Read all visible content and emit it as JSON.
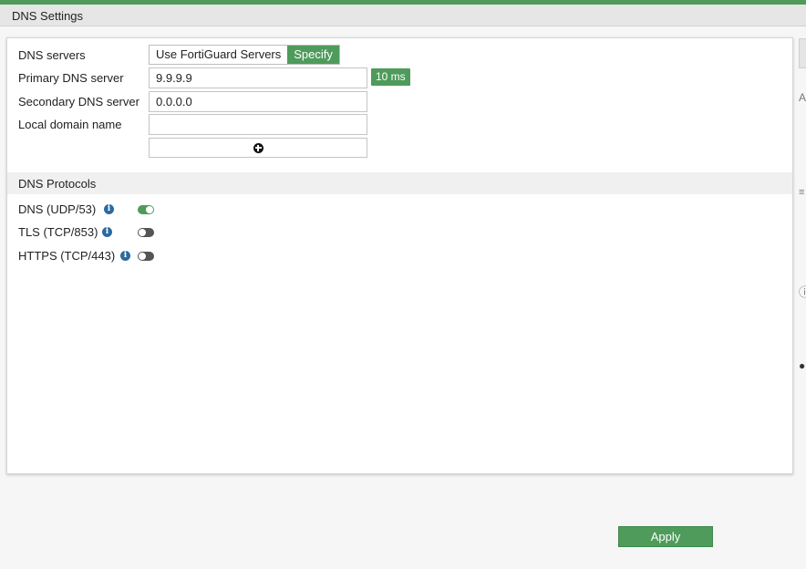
{
  "title": "DNS Settings",
  "dns_servers": {
    "label": "DNS servers",
    "options": [
      "Use FortiGuard Servers",
      "Specify"
    ],
    "selected": "Specify"
  },
  "primary": {
    "label": "Primary DNS server",
    "value": "9.9.9.9",
    "latency": "10 ms"
  },
  "secondary": {
    "label": "Secondary DNS server",
    "value": "0.0.0.0"
  },
  "local_domain": {
    "label": "Local domain name",
    "value": ""
  },
  "protocols": {
    "title": "DNS Protocols",
    "items": [
      {
        "label": "DNS (UDP/53)",
        "enabled": true
      },
      {
        "label": "TLS (TCP/853)",
        "enabled": false
      },
      {
        "label": "HTTPS (TCP/443)",
        "enabled": false
      }
    ]
  },
  "apply_label": "Apply",
  "info_glyph": "i",
  "right_rail": {
    "letter": "A",
    "icons": [
      "list-icon",
      "help-icon",
      "comment-icon"
    ]
  },
  "colors": {
    "accent": "#4e9b5c",
    "info": "#2c6aa0",
    "toggle_off": "#555555"
  }
}
